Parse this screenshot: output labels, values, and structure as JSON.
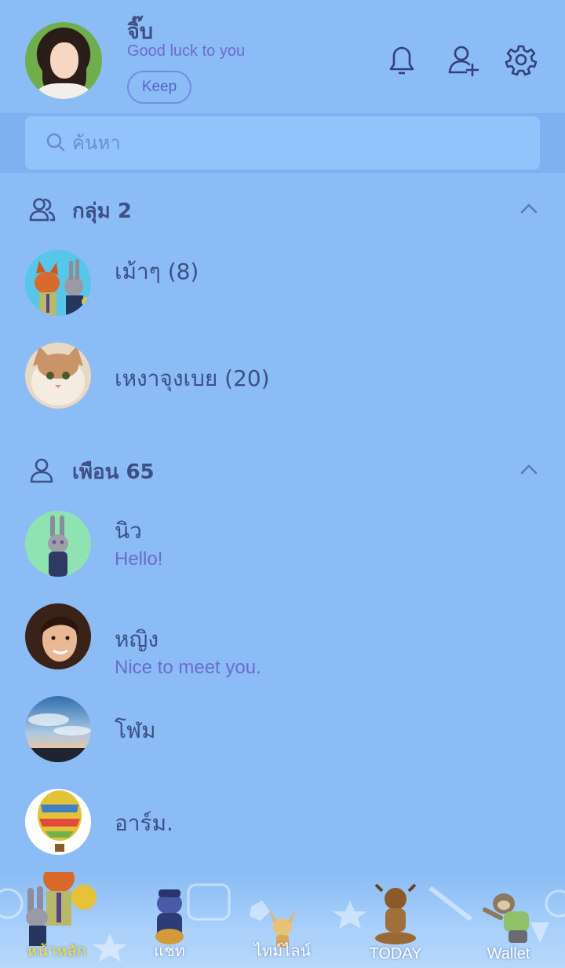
{
  "profile": {
    "name": "จิ๊บ",
    "status": "Good luck to you",
    "keep_label": "Keep"
  },
  "header_icons": [
    "bell-icon",
    "add-friend-icon",
    "gear-icon"
  ],
  "search": {
    "placeholder": "ค้นหา"
  },
  "groups": {
    "title": "กลุ่ม 2",
    "items": [
      {
        "name": "เม้าๆ (8)"
      },
      {
        "name": "เหงาจุงเบย (20)"
      }
    ]
  },
  "friends": {
    "title": "เพือน 65",
    "items": [
      {
        "name": "นิว",
        "status": "Hello!"
      },
      {
        "name": "หญิง",
        "status": "Nice to meet you."
      },
      {
        "name": "โฬม",
        "status": ""
      },
      {
        "name": "อาร์ม.",
        "status": ""
      }
    ]
  },
  "tabs": [
    {
      "label": "หน้าหลัก",
      "active": true
    },
    {
      "label": "แชท",
      "active": false
    },
    {
      "label": "ไทม์ไลน์",
      "active": false
    },
    {
      "label": "TODAY",
      "active": false
    },
    {
      "label": "Wallet",
      "active": false
    }
  ],
  "colors": {
    "background": "#8bbcf5",
    "search_band": "#7eb1ef",
    "search_box": "#92c4fb",
    "text_primary": "#3d4f86",
    "text_secondary": "#6b6bd0",
    "active_tab": "#f5e13b"
  }
}
